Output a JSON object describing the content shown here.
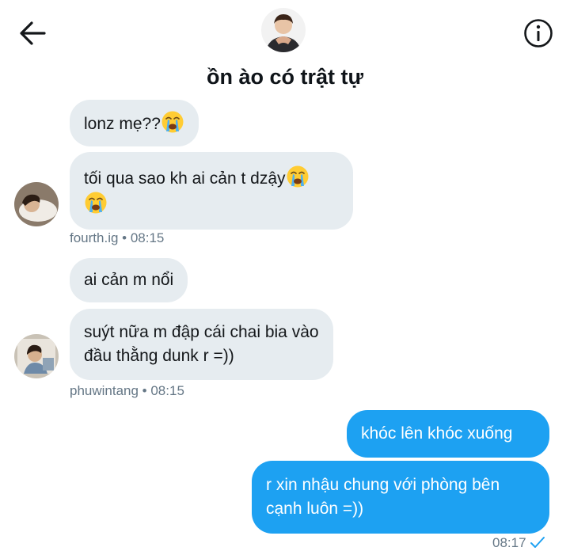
{
  "conversation": {
    "title": "ồn ào có trật tự"
  },
  "icons": {
    "back": "arrow-left-icon",
    "info": "info-circle-icon",
    "emoji": "loudly-crying-face-emoji",
    "read_receipt": "checkmark-icon"
  },
  "colors": {
    "accent": "#1da1f2",
    "incoming_bubble": "#e6ecf0",
    "meta_text": "#657786"
  },
  "messages": [
    {
      "direction": "incoming",
      "text": "lonz mẹ??"
    },
    {
      "direction": "incoming",
      "text_line1": "tối qua sao kh ai cản t dzậy",
      "sender_meta": "fourth.ig • 08:15"
    },
    {
      "direction": "incoming",
      "text": "ai cản m nổi"
    },
    {
      "direction": "incoming",
      "text_line1": "suýt nữa m đập cái chai bia vào",
      "text_line2": "đầu thằng dunk r =))",
      "sender_meta": "phuwintang • 08:15"
    },
    {
      "direction": "outgoing",
      "text": "khóc lên khóc xuống"
    },
    {
      "direction": "outgoing",
      "text_line1": "r xin nhậu chung với phòng bên",
      "text_line2": "cạnh luôn =))",
      "time": "08:17"
    }
  ]
}
